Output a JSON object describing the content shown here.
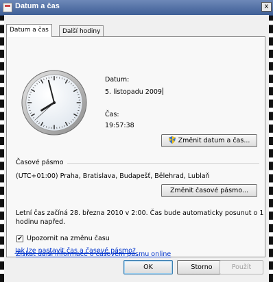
{
  "window": {
    "title": "Datum a čas",
    "close_glyph": "x"
  },
  "tabs": [
    {
      "label": "Datum a čas",
      "active": true
    },
    {
      "label": "Další hodiny",
      "active": false
    }
  ],
  "clock": {
    "time": "19:57:38"
  },
  "datetime": {
    "date_label": "Datum:",
    "date_value": "5. listopadu 2009",
    "time_label": "Čas:",
    "time_value": "19:57:38",
    "change_button": "Změnit datum a čas...",
    "change_button_icon": "uac-shield-icon"
  },
  "timezone": {
    "section_label": "Časové pásmo",
    "value": "(UTC+01:00) Praha, Bratislava, Budapešť, Bělehrad, Lublaň",
    "change_button": "Změnit časové pásmo..."
  },
  "dst": {
    "info_line1": "Letní čas začíná 28. března 2010 v 2:00. Čas bude automaticky posunut o 1",
    "info_line2": "hodinu napřed.",
    "notify_checkbox_label": "Upozornit na změnu času",
    "notify_checked": true,
    "check_glyph": "✔"
  },
  "links": {
    "timezone_info": "Získat další informace o časovém pásmu online",
    "how_to_set": "Jak lze nastavit čas a časové pásmo?"
  },
  "footer": {
    "ok": "OK",
    "cancel": "Storno",
    "apply": "Použít"
  },
  "colors": {
    "titlebar": "#4a6aa2",
    "link": "#0033cc",
    "dialog_bg": "#f0f0f0"
  }
}
